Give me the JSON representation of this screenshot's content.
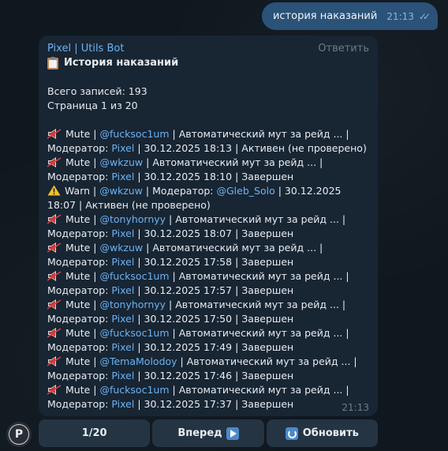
{
  "outgoing": {
    "text": "история наказаний",
    "time": "21:13"
  },
  "incoming": {
    "sender": "Pixel | Utils Bot",
    "reply": "Ответить",
    "title": "История наказаний",
    "total": "Всего записей: 193",
    "page": "Страница 1 из 20",
    "time": "21:13",
    "entries": [
      {
        "type": "Mute",
        "user": "@fucksoc1um",
        "reason": "Автоматический мут за рейд ...",
        "moderator": "Pixel",
        "date": "30.12.2025 18:13",
        "status": "Активен (не проверено)"
      },
      {
        "type": "Mute",
        "user": "@wkzuw",
        "reason": "Автоматический мут за рейд ...",
        "moderator": "Pixel",
        "date": "30.12.2025 18:10",
        "status": "Завершен"
      },
      {
        "type": "Warn",
        "user": "@wkzuw",
        "moderator": "@Gleb_Solo",
        "date": "30.12.2025 18:07",
        "status": "Активен (не проверено)"
      },
      {
        "type": "Mute",
        "user": "@tonyhornyy",
        "reason": "Автоматический мут за рейд ...",
        "moderator": "Pixel",
        "date": "30.12.2025 18:07",
        "status": "Завершен"
      },
      {
        "type": "Mute",
        "user": "@wkzuw",
        "reason": "Автоматический мут за рейд ...",
        "moderator": "Pixel",
        "date": "30.12.2025 17:58",
        "status": "Завершен"
      },
      {
        "type": "Mute",
        "user": "@fucksoc1um",
        "reason": "Автоматический мут за рейд ...",
        "moderator": "Pixel",
        "date": "30.12.2025 17:57",
        "status": "Завершен"
      },
      {
        "type": "Mute",
        "user": "@tonyhornyy",
        "reason": "Автоматический мут за рейд ...",
        "moderator": "Pixel",
        "date": "30.12.2025 17:50",
        "status": "Завершен"
      },
      {
        "type": "Mute",
        "user": "@fucksoc1um",
        "reason": "Автоматический мут за рейд ...",
        "moderator": "Pixel",
        "date": "30.12.2025 17:49",
        "status": "Завершен"
      },
      {
        "type": "Mute",
        "user": "@TemaMolodoy",
        "reason": "Автоматический мут за рейд ...",
        "moderator": "Pixel",
        "date": "30.12.2025 17:46",
        "status": "Завершен"
      },
      {
        "type": "Mute",
        "user": "@fucksoc1um",
        "reason": "Автоматический мут за рейд ...",
        "moderator": "Pixel",
        "date": "30.12.2025 17:37",
        "status": "Завершен"
      }
    ],
    "labels": {
      "sep": " | ",
      "moderator_prefix": "Модератор: "
    }
  },
  "keyboard": {
    "page_label": "1/20",
    "next_label": "Вперед",
    "refresh_label": "Обновить"
  },
  "avatar": {
    "letter": "P"
  },
  "colors": {
    "background": "#0f171f",
    "outgoing_bubble": "#2b5278",
    "incoming_bubble": "#182533",
    "link": "#6ab3f3",
    "button": "#243443"
  },
  "icons": {
    "mute": "muted-speaker-icon",
    "warn": "warning-icon",
    "title": "clipboard-icon",
    "next": "play-arrow-icon",
    "refresh": "refresh-icon",
    "read": "double-check-icon"
  }
}
